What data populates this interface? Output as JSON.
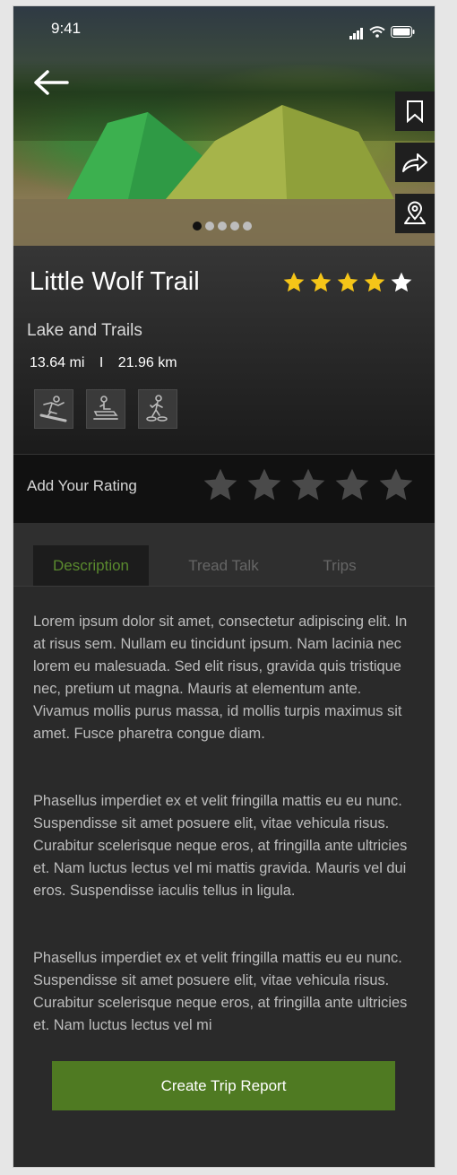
{
  "status": {
    "time": "9:41"
  },
  "trail": {
    "name": "Little Wolf Trail",
    "subtitle": "Lake and Trails",
    "distance_mi": "13.64 mi",
    "distance_sep": "I",
    "distance_km": "21.96 km",
    "rating": 4,
    "rating_max": 5,
    "activities": [
      "snowboard-icon",
      "snowmobile-icon",
      "snowshoe-icon"
    ]
  },
  "carousel": {
    "count": 5,
    "active_index": 0
  },
  "hero_actions": [
    "bookmark-icon",
    "share-icon",
    "map-pin-icon"
  ],
  "user_rating": {
    "label": "Add Your Rating",
    "value": 0
  },
  "tabs": [
    {
      "label": "Description",
      "active": true
    },
    {
      "label": "Tread Talk",
      "active": false
    },
    {
      "label": "Trips",
      "active": false
    }
  ],
  "description": {
    "paragraphs": [
      "Lorem ipsum dolor sit amet, consectetur adipiscing elit. In at risus sem. Nullam eu tincidunt ipsum. Nam lacinia nec lorem eu malesuada. Sed elit risus, gravida quis tristique nec, pretium ut magna. Mauris at elementum ante. Vivamus mollis purus massa, id mollis turpis maximus sit amet. Fusce pharetra congue diam.",
      "Phasellus imperdiet ex et velit fringilla mattis eu eu nunc. Suspendisse sit amet posuere elit, vitae vehicula risus. Curabitur scelerisque neque eros, at fringilla ante ultricies et. Nam luctus lectus vel mi mattis gravida. Mauris vel dui eros. Suspendisse iaculis tellus in ligula.",
      "Phasellus imperdiet ex et velit fringilla mattis eu eu nunc. Suspendisse sit amet posuere elit, vitae vehicula risus. Curabitur scelerisque neque eros, at fringilla ante ultricies et. Nam luctus lectus vel mi"
    ]
  },
  "cta": {
    "label": "Create Trip Report"
  },
  "colors": {
    "accent": "#4f7a22",
    "star_filled": "#f5c518",
    "star_empty": "#ffffff",
    "tab_active": "#5a8a2e"
  }
}
